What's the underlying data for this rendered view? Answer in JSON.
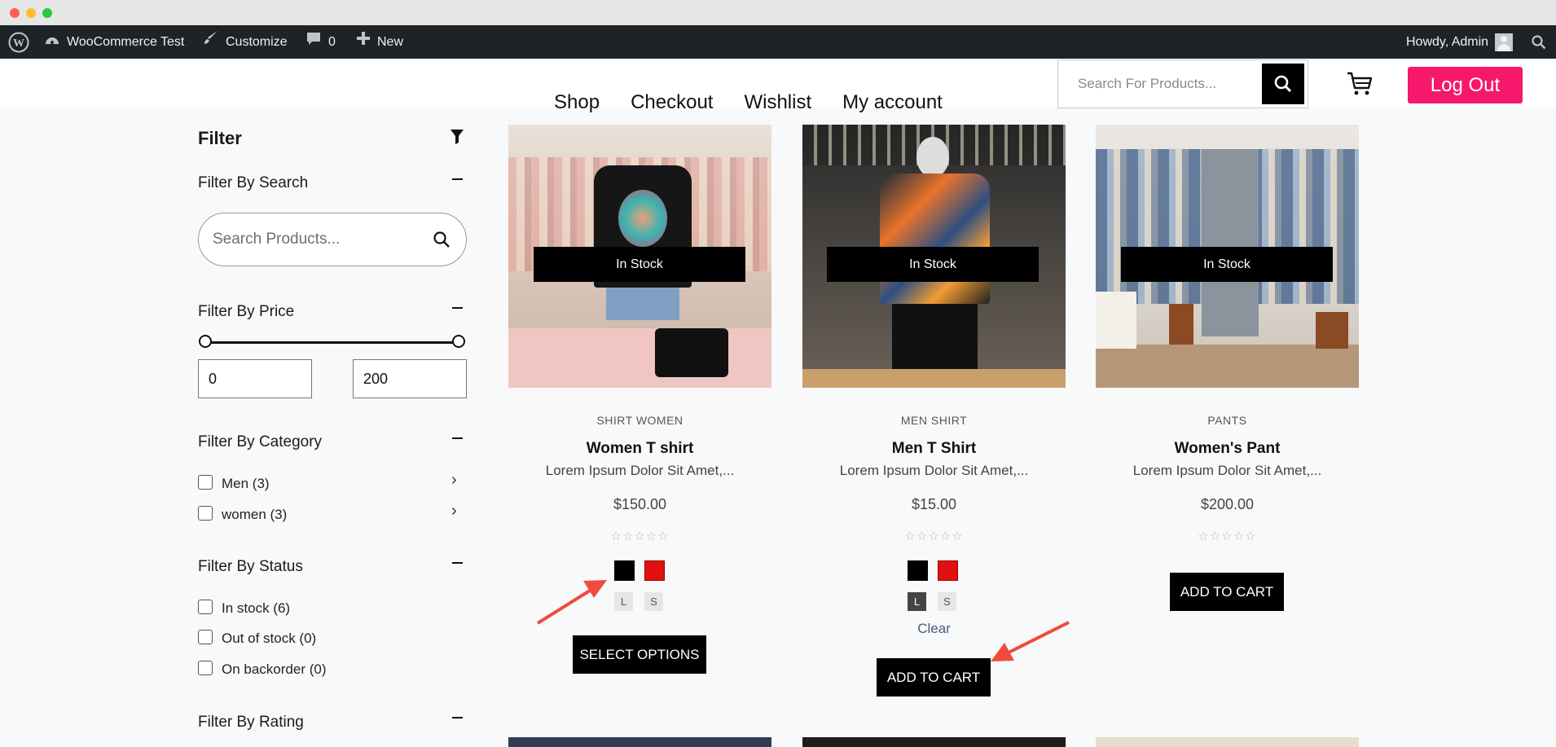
{
  "colors": {
    "accent": "#f5186b",
    "admin_bar": "#1d2327",
    "swatch_black": "#000000",
    "swatch_red": "#e31010",
    "arrow": "#f04b3b"
  },
  "admin_bar": {
    "site_name": "WooCommerce Test",
    "customize": "Customize",
    "comments_count": "0",
    "new_label": "New",
    "howdy": "Howdy, Admin"
  },
  "header": {
    "nav": [
      "Shop",
      "Checkout",
      "Wishlist",
      "My account"
    ],
    "search_placeholder": "Search For Products...",
    "logout_label": "Log Out"
  },
  "sidebar": {
    "title": "Filter",
    "search": {
      "title": "Filter By Search",
      "placeholder": "Search Products..."
    },
    "price": {
      "title": "Filter By Price",
      "min": "0",
      "max": "200"
    },
    "category": {
      "title": "Filter By Category",
      "items": [
        {
          "label": "Men (3)"
        },
        {
          "label": "women (3)"
        }
      ]
    },
    "status": {
      "title": "Filter By Status",
      "items": [
        {
          "label": "In stock (6)"
        },
        {
          "label": "Out of stock (0)"
        },
        {
          "label": "On backorder (0)"
        }
      ]
    },
    "rating": {
      "title": "Filter By Rating"
    }
  },
  "products": [
    {
      "badge": "In Stock",
      "categories": "SHIRT  WOMEN",
      "name": "Women T shirt",
      "desc": "Lorem Ipsum Dolor Sit Amet,...",
      "price": "$150.00",
      "stars": "☆☆☆☆☆",
      "rating": 0,
      "sizes": [
        "L",
        "S"
      ],
      "button": "SELECT OPTIONS"
    },
    {
      "badge": "In Stock",
      "categories": "MEN  SHIRT",
      "name": "Men T Shirt",
      "desc": "Lorem Ipsum Dolor Sit Amet,...",
      "price": "$15.00",
      "stars": "☆☆☆☆☆",
      "rating": 0,
      "sizes": [
        "L",
        "S"
      ],
      "clear": "Clear",
      "button": "ADD TO CART"
    },
    {
      "badge": "In Stock",
      "categories": "PANTS",
      "name": "Women's Pant",
      "desc": "Lorem Ipsum Dolor Sit Amet,...",
      "price": "$200.00",
      "stars": "☆☆☆☆☆",
      "rating": 0,
      "button": "ADD TO CART"
    }
  ]
}
